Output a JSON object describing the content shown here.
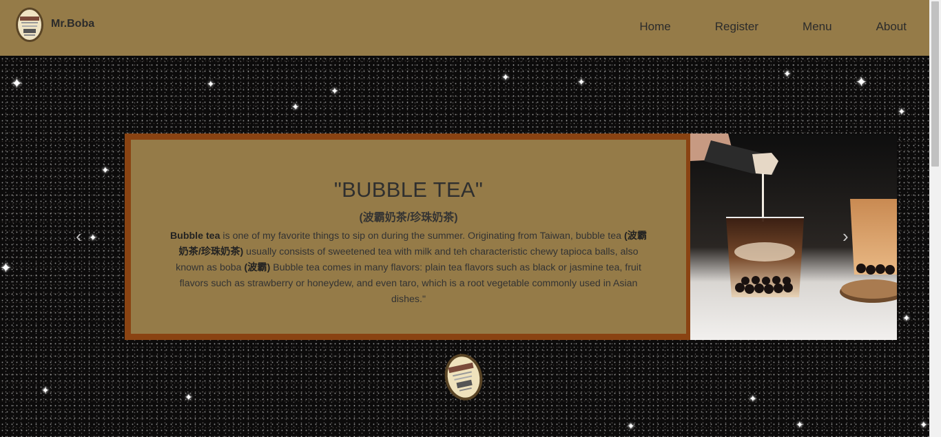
{
  "brand": {
    "name": "Mr.Boba",
    "logo_icon": "boba-cup-logo-icon"
  },
  "nav": {
    "items": [
      "Home",
      "Register",
      "Menu",
      "About"
    ]
  },
  "slide": {
    "title": "\"BUBBLE TEA\"",
    "subtitle": "(波霸奶茶/珍珠奶茶)",
    "desc_b1": "Bubble tea",
    "desc_t1": " is one of my favorite things to sip on during the summer. Originating from Taiwan, bubble tea ",
    "desc_b2": "(波霸奶茶/珍珠奶茶)",
    "desc_t2": " usually consists of sweetened tea with milk and teh characteristic chewy tapioca balls, also known as boba ",
    "desc_b3": "(波霸)",
    "desc_t3": " Bubble tea comes in many flavors: plain tea flavors such as black or jasmine tea, fruit flavors such as strawberry or honeydew, and even taro, which is a root vegetable commonly used in Asian dishes.\"",
    "image": "milk-pouring-into-iced-boba-tea-photo"
  },
  "carousel": {
    "prev": "‹",
    "next": "›"
  },
  "colors": {
    "header": "#957b48",
    "panel_border": "#8a4312",
    "background": "#0c0b0b"
  }
}
